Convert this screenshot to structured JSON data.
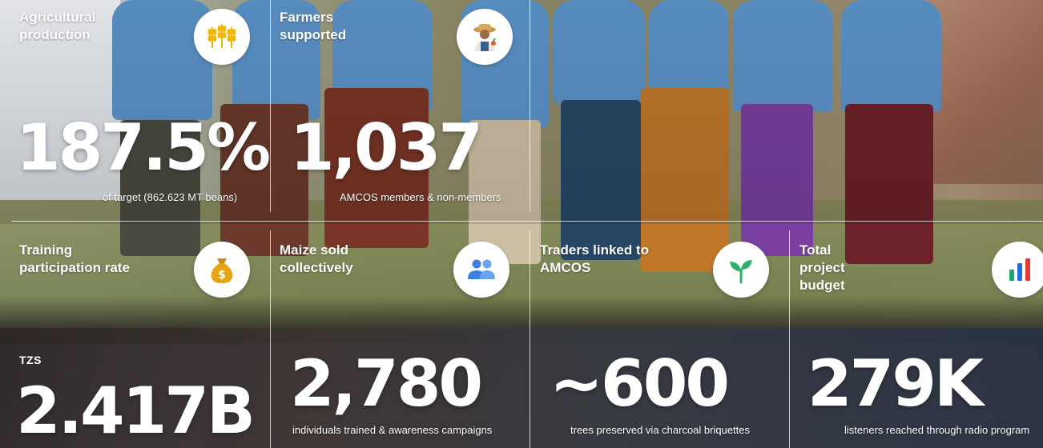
{
  "stats": [
    {
      "title": "Agricultural production",
      "value": "187.5%",
      "caption": "of target (862.623 MT beans)",
      "icon": "wheat-icon"
    },
    {
      "title": "Farmers supported",
      "value": "1,037",
      "caption": "AMCOS members & non-members",
      "icon": "farmer-icon"
    },
    {
      "title": "Training participation rate",
      "prefix": "TZS",
      "value": "2.417B",
      "caption": "",
      "icon": "money-bag-icon"
    },
    {
      "title": "Maize sold collectively",
      "value": "2,780",
      "caption": "individuals trained & awareness campaigns",
      "icon": "people-icon"
    },
    {
      "title": "Traders linked to AMCOS",
      "value": "~600",
      "caption": "trees preserved via charcoal briquettes",
      "icon": "seedling-icon"
    },
    {
      "title": "Total project budget",
      "value": "279K",
      "caption": "listeners reached through radio program",
      "icon": "bar-chart-icon"
    }
  ],
  "colors": {
    "icon_wheat": "#f2b705",
    "icon_money": "#e6a415",
    "icon_people": "#3f7fe0",
    "icon_seedling": "#2fb06a",
    "icon_chart_red": "#e53935",
    "icon_chart_blue": "#1e6fe0",
    "icon_chart_green": "#1aa86a",
    "divider": "#ffffff"
  }
}
